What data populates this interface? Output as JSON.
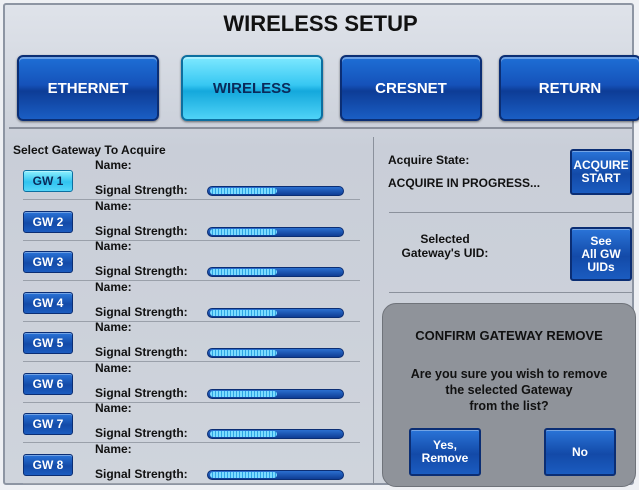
{
  "header": {
    "title": "WIRELESS SETUP"
  },
  "nav": {
    "items": [
      {
        "label": "ETHERNET",
        "active": false
      },
      {
        "label": "WIRELESS",
        "active": true
      },
      {
        "label": "CRESNET",
        "active": false
      },
      {
        "label": "RETURN",
        "active": false
      }
    ]
  },
  "gateways": {
    "heading": "Select Gateway To Acquire",
    "name_label": "Name:",
    "signal_label": "Signal Strength:",
    "items": [
      {
        "label": "GW 1",
        "selected": true,
        "signal": 0.5
      },
      {
        "label": "GW 2",
        "selected": false,
        "signal": 0.5
      },
      {
        "label": "GW 3",
        "selected": false,
        "signal": 0.5
      },
      {
        "label": "GW 4",
        "selected": false,
        "signal": 0.5
      },
      {
        "label": "GW 5",
        "selected": false,
        "signal": 0.5
      },
      {
        "label": "GW 6",
        "selected": false,
        "signal": 0.5
      },
      {
        "label": "GW 7",
        "selected": false,
        "signal": 0.5
      },
      {
        "label": "GW 8",
        "selected": false,
        "signal": 0.5
      }
    ]
  },
  "acquire": {
    "state_label": "Acquire State:",
    "state_value": "ACQUIRE IN PROGRESS...",
    "button_line1": "ACQUIRE",
    "button_line2": "START"
  },
  "uid": {
    "label_line1": "Selected",
    "label_line2": "Gateway's UID:",
    "button_line1": "See",
    "button_line2": "All GW",
    "button_line3": "UIDs"
  },
  "confirm": {
    "title": "CONFIRM GATEWAY REMOVE",
    "message_line1": "Are you sure you wish to remove",
    "message_line2": "the selected Gateway",
    "message_line3": "from the list?",
    "yes_line1": "Yes,",
    "yes_line2": "Remove",
    "no_label": "No"
  }
}
